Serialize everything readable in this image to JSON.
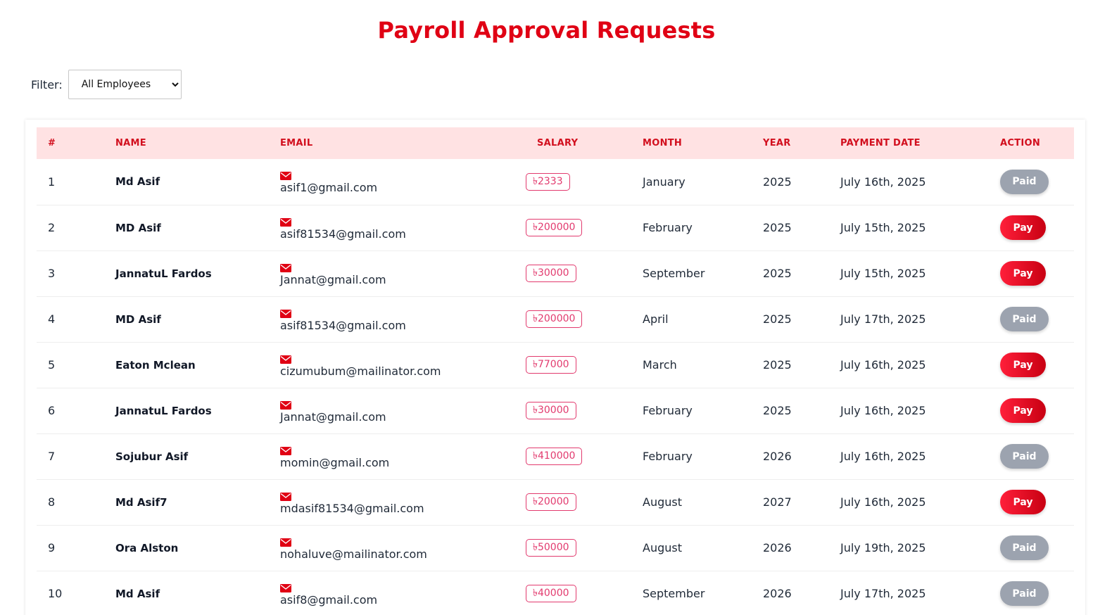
{
  "page": {
    "title": "Payroll Approval Requests"
  },
  "filter": {
    "label": "Filter:",
    "selected": "All Employees"
  },
  "table": {
    "columns": [
      "#",
      "NAME",
      "EMAIL",
      "SALARY",
      "MONTH",
      "YEAR",
      "PAYMENT DATE",
      "ACTION"
    ],
    "rows": [
      {
        "num": "1",
        "name": "Md Asif",
        "email": "asif1@gmail.com",
        "salary": "৳2333",
        "month": "January",
        "year": "2025",
        "date": "July 16th, 2025",
        "action": "Paid"
      },
      {
        "num": "2",
        "name": "MD Asif",
        "email": "asif81534@gmail.com",
        "salary": "৳200000",
        "month": "February",
        "year": "2025",
        "date": "July 15th, 2025",
        "action": "Pay"
      },
      {
        "num": "3",
        "name": "JannatuL Fardos",
        "email": "Jannat@gmail.com",
        "salary": "৳30000",
        "month": "September",
        "year": "2025",
        "date": "July 15th, 2025",
        "action": "Pay"
      },
      {
        "num": "4",
        "name": "MD Asif",
        "email": "asif81534@gmail.com",
        "salary": "৳200000",
        "month": "April",
        "year": "2025",
        "date": "July 17th, 2025",
        "action": "Paid"
      },
      {
        "num": "5",
        "name": "Eaton Mclean",
        "email": "cizumubum@mailinator.com",
        "salary": "৳77000",
        "month": "March",
        "year": "2025",
        "date": "July 16th, 2025",
        "action": "Pay"
      },
      {
        "num": "6",
        "name": "JannatuL Fardos",
        "email": "Jannat@gmail.com",
        "salary": "৳30000",
        "month": "February",
        "year": "2025",
        "date": "July 16th, 2025",
        "action": "Pay"
      },
      {
        "num": "7",
        "name": "Sojubur Asif",
        "email": "momin@gmail.com",
        "salary": "৳410000",
        "month": "February",
        "year": "2026",
        "date": "July 16th, 2025",
        "action": "Paid"
      },
      {
        "num": "8",
        "name": "Md Asif7",
        "email": "mdasif81534@gmail.com",
        "salary": "৳20000",
        "month": "August",
        "year": "2027",
        "date": "July 16th, 2025",
        "action": "Pay"
      },
      {
        "num": "9",
        "name": "Ora Alston",
        "email": "nohaluve@mailinator.com",
        "salary": "৳50000",
        "month": "August",
        "year": "2026",
        "date": "July 19th, 2025",
        "action": "Paid"
      },
      {
        "num": "10",
        "name": "Md Asif",
        "email": "asif8@gmail.com",
        "salary": "৳40000",
        "month": "September",
        "year": "2026",
        "date": "July 17th, 2025",
        "action": "Paid"
      }
    ]
  },
  "colors": {
    "accent": "#e00014",
    "header_bg": "#ffe2e3",
    "salary_badge": "#e23a6e",
    "paid_button": "#9ca3af",
    "pay_button": "#e8101f"
  },
  "icons": {
    "email": "envelope-icon"
  }
}
